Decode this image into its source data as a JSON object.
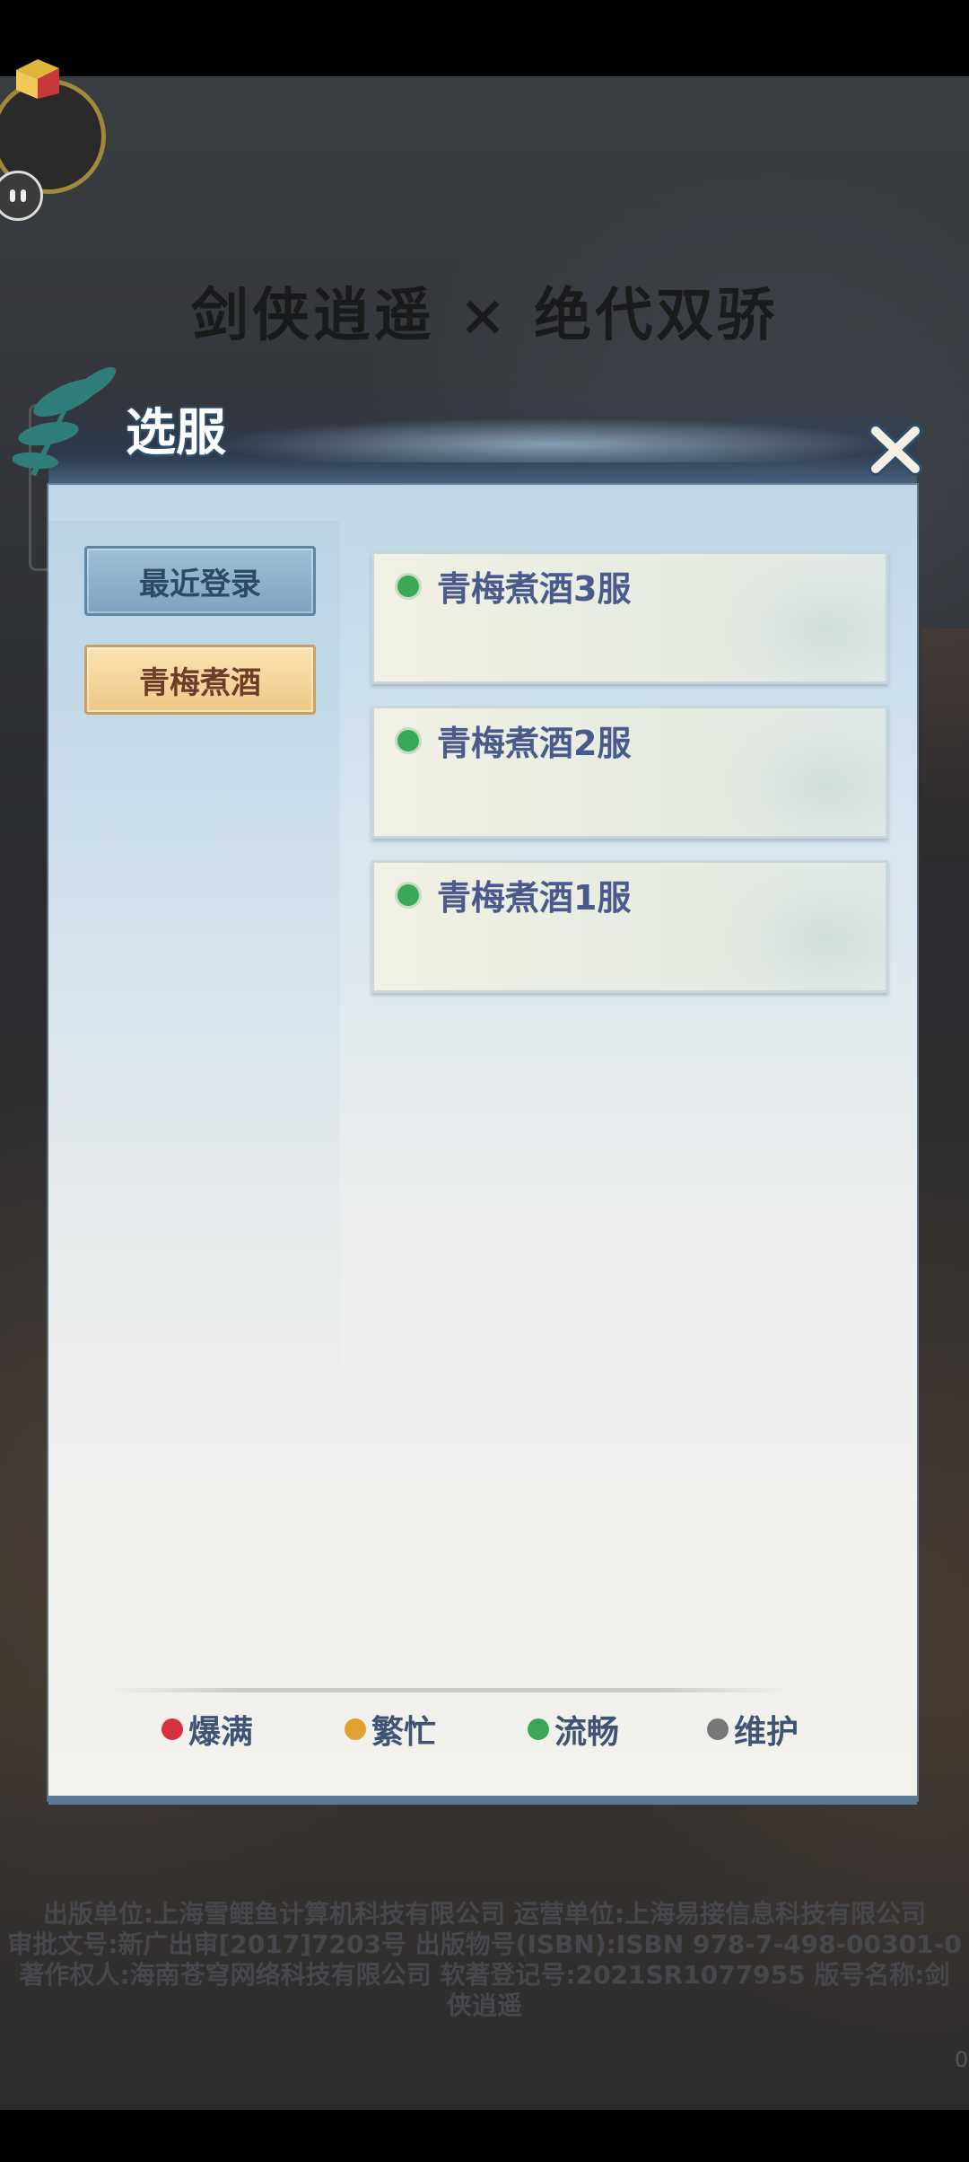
{
  "game_logo": "剑侠逍遥 × 绝代双骄",
  "panel": {
    "title": "选服",
    "categories": [
      {
        "label": "最近登录",
        "state": "normal"
      },
      {
        "label": "青梅煮酒",
        "state": "selected"
      }
    ],
    "servers": [
      {
        "name": "青梅煮酒3服",
        "status": "流畅"
      },
      {
        "name": "青梅煮酒2服",
        "status": "流畅"
      },
      {
        "name": "青梅煮酒1服",
        "status": "流畅"
      }
    ],
    "legend": [
      {
        "label": "爆满",
        "color": "#d8303c"
      },
      {
        "label": "繁忙",
        "color": "#e2a233"
      },
      {
        "label": "流畅",
        "color": "#3aa857"
      },
      {
        "label": "维护",
        "color": "#777777"
      }
    ]
  },
  "copyright": {
    "line1": "出版单位:上海雪鲤鱼计算机科技有限公司 运营单位:上海易接信息科技有限公司",
    "line2": "审批文号:新广出审[2017]7203号 出版物号(ISBN):ISBN 978-7-498-00301-0",
    "line3": "著作权人:海南苍穹网络科技有限公司 软著登记号:2021SR1077955 版号名称:剑",
    "line4": "侠逍遥"
  },
  "version_fragment": "0"
}
